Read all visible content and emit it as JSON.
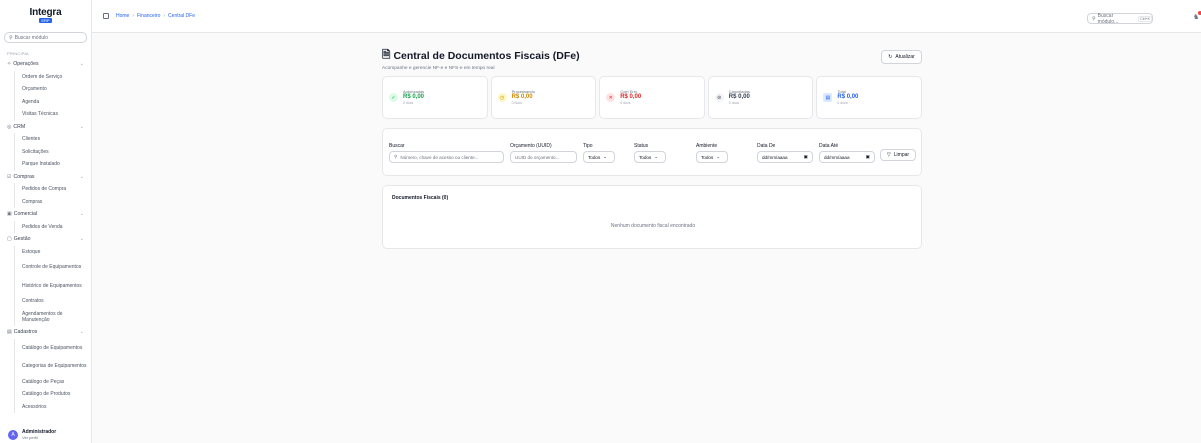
{
  "brand": {
    "name": "Integra",
    "sub": "ERP"
  },
  "sidebar": {
    "search_placeholder": "Buscar módulo",
    "section": "PRINCIPAL",
    "groups": [
      {
        "label": "Operações",
        "items": [
          "Ordem de Serviço",
          "Orçamento",
          "Agenda",
          "Visitas Técnicas"
        ]
      },
      {
        "label": "CRM",
        "items": [
          "Clientes",
          "Solicitações",
          "Parque Instalado"
        ]
      },
      {
        "label": "Compras",
        "items": [
          "Pedidos de Compra",
          "Compras"
        ]
      },
      {
        "label": "Comercial",
        "items": [
          "Pedidos de Venda"
        ]
      },
      {
        "label": "Gestão",
        "items": [
          "Estoque",
          "Controle de Equipamentos",
          "Histórico de Equipamentos",
          "Contratos",
          "Agendamentos de Manutenção"
        ]
      },
      {
        "label": "Cadastros",
        "items": [
          "Catálogo de Equipamentos",
          "Categorias de Equipamentos",
          "Catálogo de Peças",
          "Catálogo de Produtos",
          "Acessórios"
        ]
      }
    ],
    "user": {
      "initial": "A",
      "name": "Administrador",
      "sub": "Ver perfil"
    }
  },
  "topbar": {
    "breadcrumb": [
      "Home",
      "Financeiro",
      "Central DFe"
    ],
    "search_placeholder": "Buscar módulo...",
    "shortcut": "Ctrl+K"
  },
  "page": {
    "title": "Central de Documentos Fiscais (DFe)",
    "subtitle": "Acompanhe e gerencie NF-e e NFS-e em tempo real",
    "refresh_label": "Atualizar"
  },
  "cards": [
    {
      "label": "Autorizadas",
      "value": "R$ 0,00",
      "count": "0 docs",
      "color": "#16a34a",
      "bg": "#dcfce7",
      "icon": "check-circle-icon"
    },
    {
      "label": "Processando",
      "value": "R$ 0,00",
      "count": "0 docs",
      "color": "#ca8a04",
      "bg": "#fef9c3",
      "icon": "clock-icon"
    },
    {
      "label": "Com Erro",
      "value": "R$ 0,00",
      "count": "0 docs",
      "color": "#dc2626",
      "bg": "#fee2e2",
      "icon": "x-circle-icon"
    },
    {
      "label": "Canceladas",
      "value": "R$ 0,00",
      "count": "0 docs",
      "color": "#374151",
      "bg": "#f3f4f6",
      "icon": "ban-icon"
    },
    {
      "label": "Total",
      "value": "R$ 0,00",
      "count": "0 docs",
      "color": "#2563eb",
      "bg": "#dbeafe",
      "icon": "document-icon"
    }
  ],
  "filters": {
    "search_label": "Buscar",
    "search_placeholder": "Número, chave de acesso ou cliente...",
    "orcamento_label": "Orçamento (UUID)",
    "orcamento_placeholder": "UUID do orçamento...",
    "tipo_label": "Tipo",
    "tipo_value": "Todos",
    "status_label": "Status",
    "status_value": "Todos",
    "ambiente_label": "Ambiente",
    "ambiente_value": "Todos",
    "data_de_label": "Data De",
    "data_de_placeholder": "dd/mm/aaaa",
    "data_ate_label": "Data Até",
    "data_ate_placeholder": "dd/mm/aaaa",
    "clear_label": "Limpar"
  },
  "documents": {
    "title": "Documentos Fiscais (0)",
    "empty": "Nenhum documento fiscal encontrado"
  }
}
